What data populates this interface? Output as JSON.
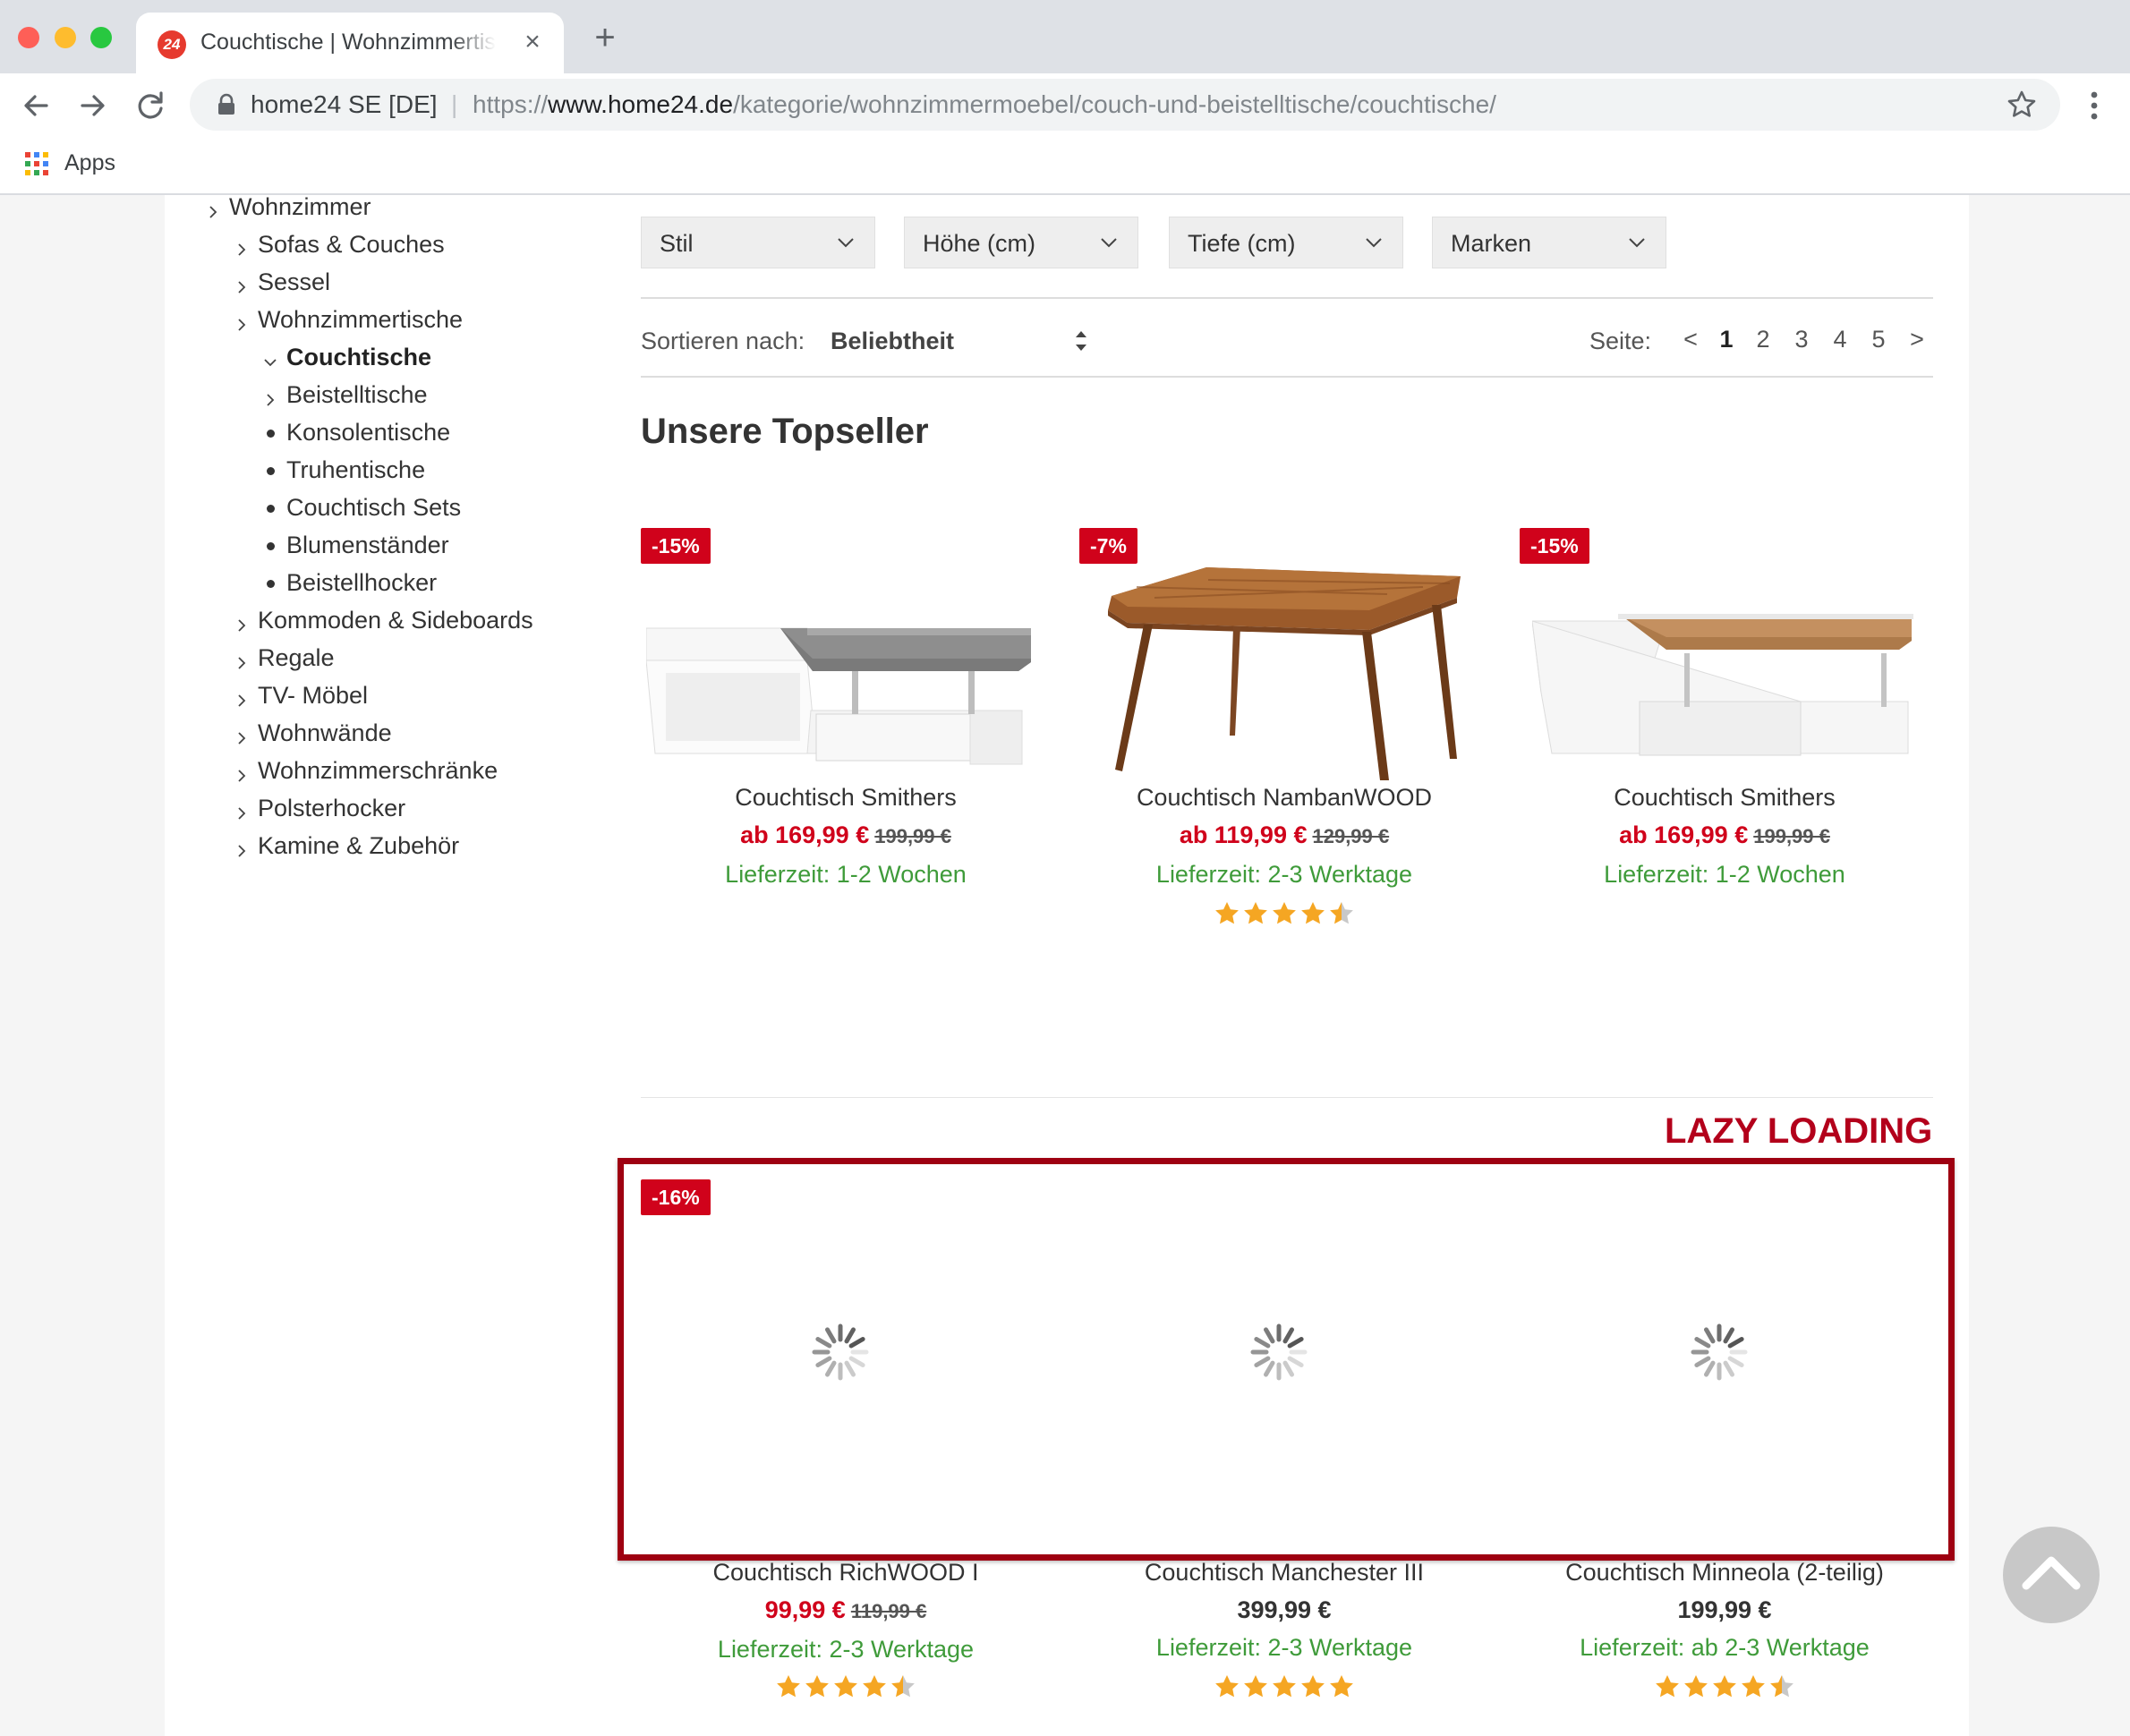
{
  "browser": {
    "tab_title": "Couchtische | Wohnzimmertische | home24",
    "favicon_text": "24",
    "site_identity": "home24 SE [DE]",
    "url_scheme": "https://",
    "url_host": "www.home24.de",
    "url_path": "/kategorie/wohnzimmermoebel/couch-und-beistelltische/couchtische/",
    "bookmarks_apps_label": "Apps"
  },
  "sidebar": {
    "items": [
      {
        "label": "Wohnzimmer",
        "marker": "chevron-right"
      },
      {
        "label": "Sofas & Couches",
        "marker": "chevron-right"
      },
      {
        "label": "Sessel",
        "marker": "chevron-right"
      },
      {
        "label": "Wohnzimmertische",
        "marker": "chevron-right"
      },
      {
        "label": "Couchtische",
        "marker": "chevron-down",
        "active": true
      },
      {
        "label": "Beistelltische",
        "marker": "chevron-right"
      },
      {
        "label": "Konsolentische",
        "marker": "bullet"
      },
      {
        "label": "Truhentische",
        "marker": "bullet"
      },
      {
        "label": "Couchtisch Sets",
        "marker": "bullet"
      },
      {
        "label": "Blumenständer",
        "marker": "bullet"
      },
      {
        "label": "Beistellhocker",
        "marker": "bullet"
      },
      {
        "label": "Kommoden & Sideboards",
        "marker": "chevron-right"
      },
      {
        "label": "Regale",
        "marker": "chevron-right"
      },
      {
        "label": "TV- Möbel",
        "marker": "chevron-right"
      },
      {
        "label": "Wohnwände",
        "marker": "chevron-right"
      },
      {
        "label": "Wohnzimmerschränke",
        "marker": "chevron-right"
      },
      {
        "label": "Polsterhocker",
        "marker": "chevron-right"
      },
      {
        "label": "Kamine & Zubehör",
        "marker": "chevron-right"
      }
    ]
  },
  "filters": [
    {
      "label": "Stil"
    },
    {
      "label": "Höhe (cm)"
    },
    {
      "label": "Tiefe (cm)"
    },
    {
      "label": "Marken"
    }
  ],
  "sort": {
    "label": "Sortieren nach:",
    "value": "Beliebtheit"
  },
  "pagination": {
    "label": "Seite:",
    "prev": "<",
    "pages": [
      "1",
      "2",
      "3",
      "4",
      "5"
    ],
    "current": "1",
    "next": ">"
  },
  "topseller": {
    "title": "Unsere Topseller",
    "products": [
      {
        "badge": "-15%",
        "name": "Couchtisch Smithers",
        "price": "ab 169,99 €",
        "old_price": "199,99 €",
        "delivery": "Lieferzeit: 1-2 Wochen",
        "image": "coffee-table-white-grey"
      },
      {
        "badge": "-7%",
        "name": "Couchtisch NambanWOOD",
        "price": "ab 119,99 €",
        "old_price": "129,99 €",
        "delivery": "Lieferzeit: 2-3 Werktage",
        "rating": 4.5,
        "image": "coffee-table-wood"
      },
      {
        "badge": "-15%",
        "name": "Couchtisch Smithers",
        "price": "ab 169,99 €",
        "old_price": "199,99 €",
        "delivery": "Lieferzeit: 1-2 Wochen",
        "image": "coffee-table-white-oak"
      }
    ]
  },
  "lazy_loading_label": "LAZY LOADING",
  "lazy_products": [
    {
      "badge": "-16%",
      "name": "Couchtisch RichWOOD I",
      "price": "99,99 €",
      "old_price": "119,99 €",
      "delivery": "Lieferzeit: 2-3 Werktage",
      "rating": 4.5
    },
    {
      "badge": "",
      "name": "Couchtisch Manchester III",
      "price": "399,99 €",
      "old_price": "",
      "delivery": "Lieferzeit: 2-3 Werktage",
      "rating": 5
    },
    {
      "badge": "",
      "name": "Couchtisch Minneola (2-teilig)",
      "price": "199,99 €",
      "old_price": "",
      "delivery": "Lieferzeit: ab 2-3 Werktage",
      "rating": 4.5
    }
  ],
  "colors": {
    "brand_red": "#d0021b",
    "delivery_green": "#3f9b3a",
    "star_orange": "#f5a623",
    "highlight_border": "#9e0011"
  }
}
